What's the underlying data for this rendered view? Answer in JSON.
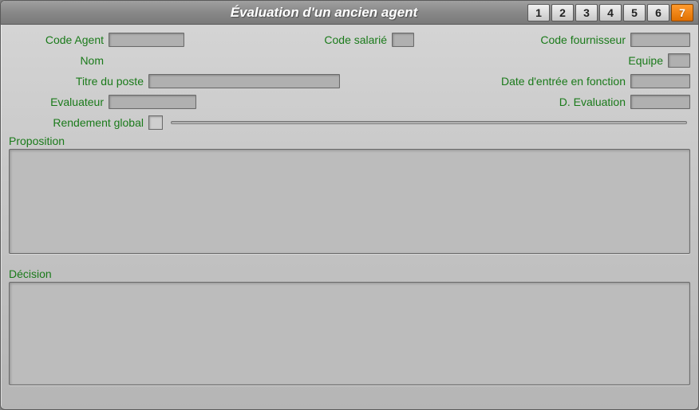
{
  "title": "Évaluation d'un ancien agent",
  "tabs": [
    "1",
    "2",
    "3",
    "4",
    "5",
    "6",
    "7"
  ],
  "active_tab": "7",
  "labels": {
    "code_agent": "Code Agent",
    "code_salarie": "Code salarié",
    "code_fournisseur": "Code fournisseur",
    "nom": "Nom",
    "equipe": "Equipe",
    "titre_poste": "Titre du poste",
    "date_entree": "Date d'entrée en fonction",
    "evaluateur": "Evaluateur",
    "d_evaluation": "D. Evaluation",
    "rendement_global": "Rendement global",
    "proposition": "Proposition",
    "decision": "Décision"
  },
  "values": {
    "code_agent": "",
    "code_salarie": "",
    "code_fournisseur": "",
    "nom": "",
    "equipe": "",
    "titre_poste": "",
    "date_entree": "",
    "evaluateur": "",
    "d_evaluation": "",
    "rendement_global": "",
    "proposition": "",
    "decision": ""
  }
}
